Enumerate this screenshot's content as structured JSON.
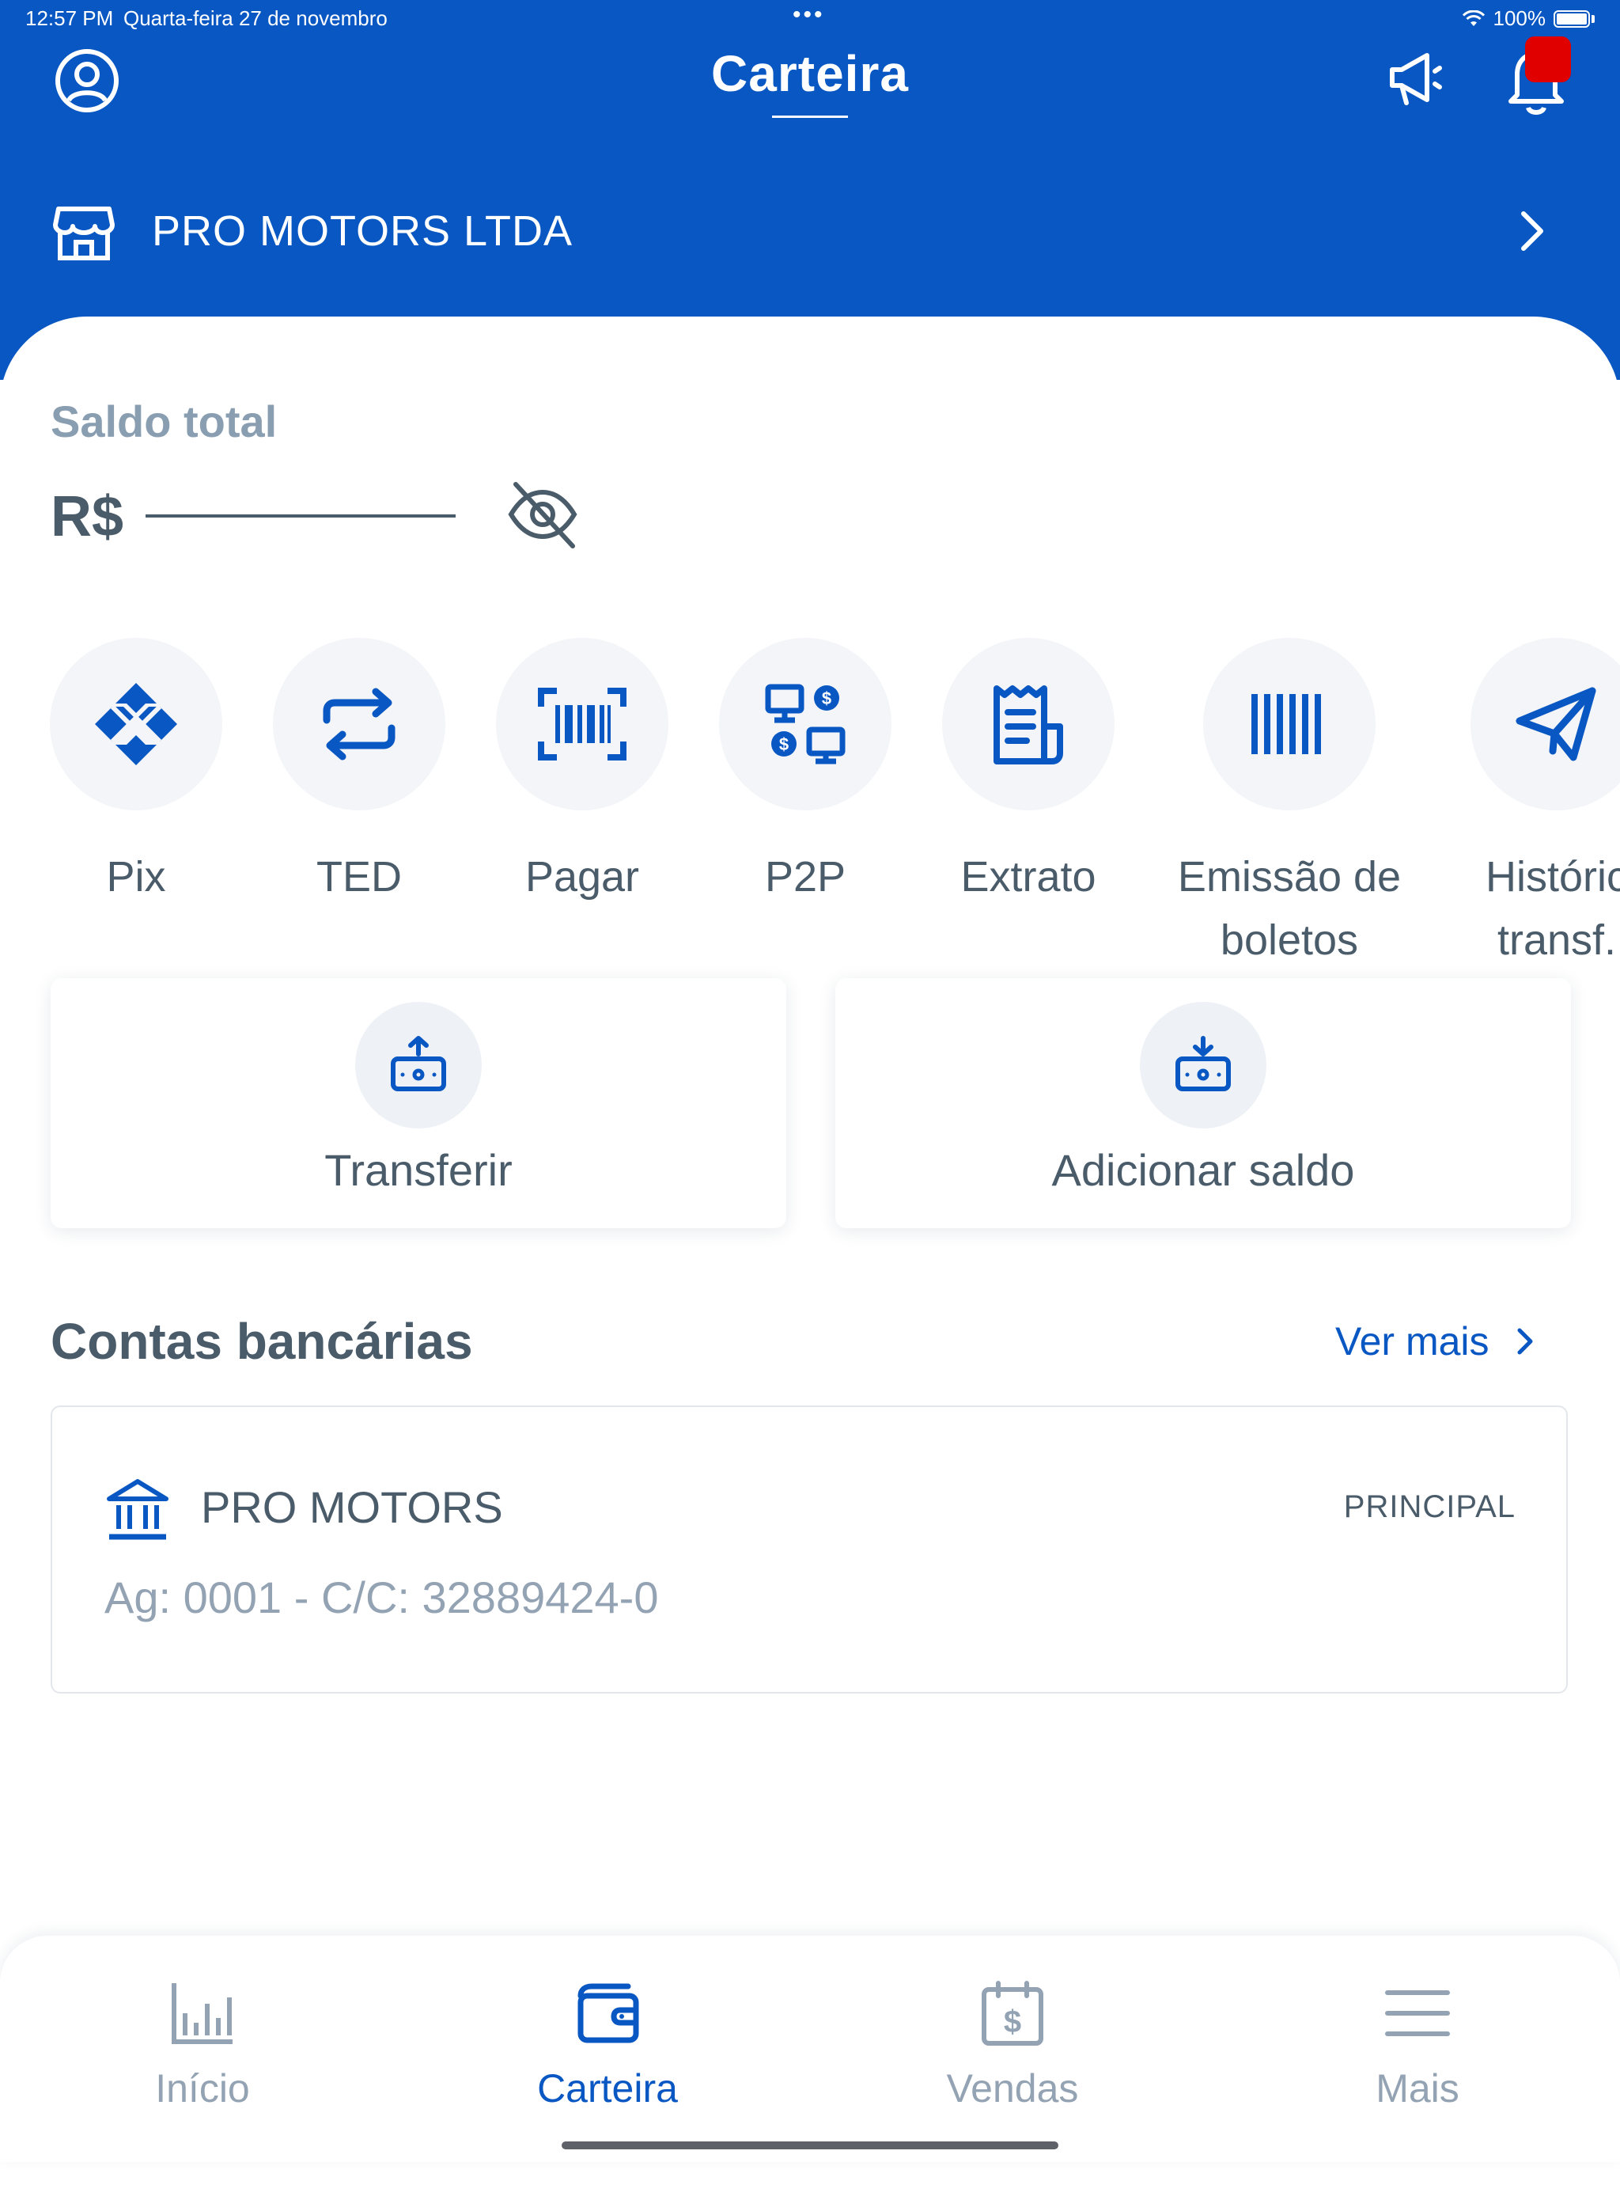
{
  "status_bar": {
    "time": "12:57 PM",
    "date": "Quarta-feira 27 de novembro",
    "dots": "•••",
    "battery": "100%"
  },
  "header": {
    "title": "Carteira",
    "company": "PRO MOTORS LTDA"
  },
  "balance": {
    "label": "Saldo total",
    "currency": "R$"
  },
  "actions": [
    {
      "label": "Pix",
      "icon": "pix-icon"
    },
    {
      "label": "TED",
      "icon": "transfer-arrows-icon"
    },
    {
      "label": "Pagar",
      "icon": "barcode-scan-icon"
    },
    {
      "label": "P2P",
      "icon": "p2p-icon"
    },
    {
      "label": "Extrato",
      "icon": "receipt-icon"
    },
    {
      "label": "Emissão de boletos",
      "icon": "barcode-icon"
    },
    {
      "label": "Históric transf.",
      "icon": "paper-plane-icon"
    }
  ],
  "cards": {
    "transfer": "Transferir",
    "add_balance": "Adicionar saldo"
  },
  "accounts": {
    "title": "Contas bancárias",
    "see_more": "Ver mais",
    "items": [
      {
        "name": "PRO MOTORS",
        "badge": "PRINCIPAL",
        "details": "Ag: 0001 - C/C: 32889424-0"
      }
    ]
  },
  "tabs": [
    {
      "label": "Início",
      "icon": "bar-chart-icon"
    },
    {
      "label": "Carteira",
      "icon": "wallet-icon",
      "active": true
    },
    {
      "label": "Vendas",
      "icon": "calendar-dollar-icon"
    },
    {
      "label": "Mais",
      "icon": "menu-icon"
    }
  ],
  "colors": {
    "primary": "#0957C3",
    "notification": "#E00000",
    "text": "#4A5B6A",
    "muted": "#93A3B3"
  }
}
